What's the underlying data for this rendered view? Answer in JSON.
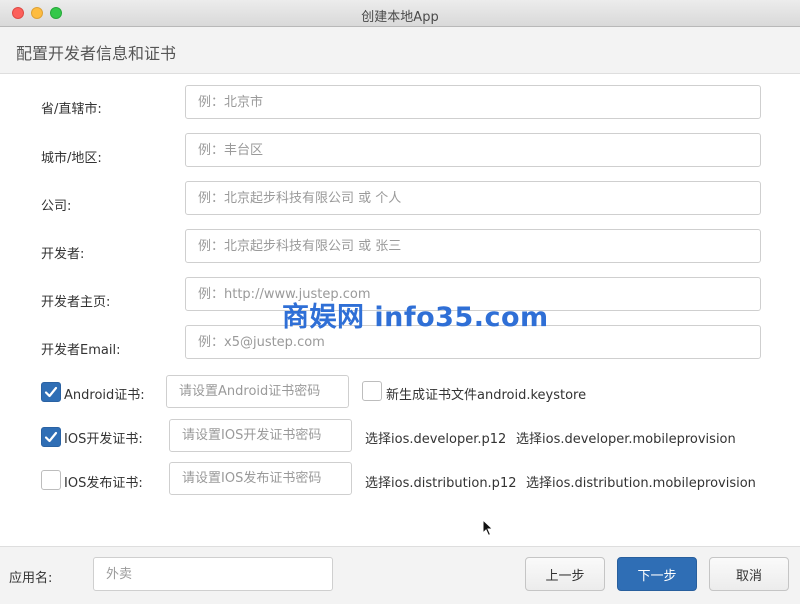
{
  "window": {
    "title": "创建本地App"
  },
  "header": {
    "title": "配置开发者信息和证书"
  },
  "form": {
    "province": {
      "label": "省/直辖市:",
      "placeholder": "例：北京市"
    },
    "city": {
      "label": "城市/地区:",
      "placeholder": "例：丰台区"
    },
    "company": {
      "label": "公司:",
      "placeholder": "例：北京起步科技有限公司 或 个人"
    },
    "developer": {
      "label": "开发者:",
      "placeholder": "例：北京起步科技有限公司 或 张三"
    },
    "homepage": {
      "label": "开发者主页:",
      "placeholder": "例：http://www.justep.com"
    },
    "email": {
      "label": "开发者Email:",
      "placeholder": "例：x5@justep.com"
    }
  },
  "certs": {
    "android": {
      "label": "Android证书:",
      "checked": true,
      "password_placeholder": "请设置Android证书密码",
      "new_keystore_label": "新生成证书文件android.keystore",
      "new_keystore_checked": false
    },
    "ios_dev": {
      "label": "IOS开发证书:",
      "checked": true,
      "password_placeholder": "请设置IOS开发证书密码",
      "p12_link": "选择ios.developer.p12",
      "provision_link": "选择ios.developer.mobileprovision"
    },
    "ios_dist": {
      "label": "IOS发布证书:",
      "checked": false,
      "password_placeholder": "请设置IOS发布证书密码",
      "p12_link": "选择ios.distribution.p12",
      "provision_link": "选择ios.distribution.mobileprovision"
    }
  },
  "footer": {
    "app_name_label": "应用名:",
    "app_name_value": "外卖",
    "prev_label": "上一步",
    "next_label": "下一步",
    "cancel_label": "取消"
  },
  "watermark": "商娱网 info35.com",
  "colors": {
    "accent": "#2f6eb5",
    "watermark": "#2f6fd6"
  }
}
